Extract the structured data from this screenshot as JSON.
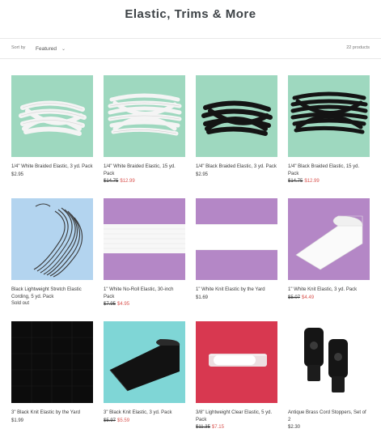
{
  "page": {
    "title": "Elastic, Trims & More"
  },
  "toolbar": {
    "sort_label": "Sort by",
    "sort_value": "Featured",
    "count": "22 products"
  },
  "products": [
    {
      "title": "1/4\" White Braided Elastic, 3 yd. Pack",
      "price": "$2.95",
      "old_price": "",
      "sale_price": "",
      "sold_out": ""
    },
    {
      "title": "1/4\" White Braided Elastic, 15 yd. Pack",
      "price": "",
      "old_price": "$14.75",
      "sale_price": "$12.99",
      "sold_out": ""
    },
    {
      "title": "1/4\" Black Braided Elastic, 3 yd. Pack",
      "price": "$2.95",
      "old_price": "",
      "sale_price": "",
      "sold_out": ""
    },
    {
      "title": "1/4\" Black Braided Elastic, 15 yd. Pack",
      "price": "",
      "old_price": "$14.75",
      "sale_price": "$12.99",
      "sold_out": ""
    },
    {
      "title": "Black Lightweight Stretch Elastic Cording, 5 yd. Pack",
      "price": "",
      "old_price": "",
      "sale_price": "",
      "sold_out": "Sold out"
    },
    {
      "title": "1\" White No-Roll Elastic, 30-inch Pack",
      "price": "",
      "old_price": "$7.95",
      "sale_price": "$4.95",
      "sold_out": ""
    },
    {
      "title": "1\" White Knit Elastic by the Yard",
      "price": "$1.69",
      "old_price": "",
      "sale_price": "",
      "sold_out": ""
    },
    {
      "title": "1\" White Knit Elastic, 3 yd. Pack",
      "price": "",
      "old_price": "$5.07",
      "sale_price": "$4.49",
      "sold_out": ""
    },
    {
      "title": "3\" Black Knit Elastic by the Yard",
      "price": "$1.99",
      "old_price": "",
      "sale_price": "",
      "sold_out": ""
    },
    {
      "title": "3\" Black Knit Elastic, 3 yd. Pack",
      "price": "",
      "old_price": "$5.97",
      "sale_price": "$5.59",
      "sold_out": ""
    },
    {
      "title": "3/8\" Lightweight Clear Elastic, 5 yd. Pack",
      "price": "",
      "old_price": "$11.35",
      "sale_price": "$7.15",
      "sold_out": ""
    },
    {
      "title": "Antique Brass Cord Stoppers, Set of 2",
      "price": "$2.30",
      "old_price": "",
      "sale_price": "",
      "sold_out": ""
    }
  ]
}
